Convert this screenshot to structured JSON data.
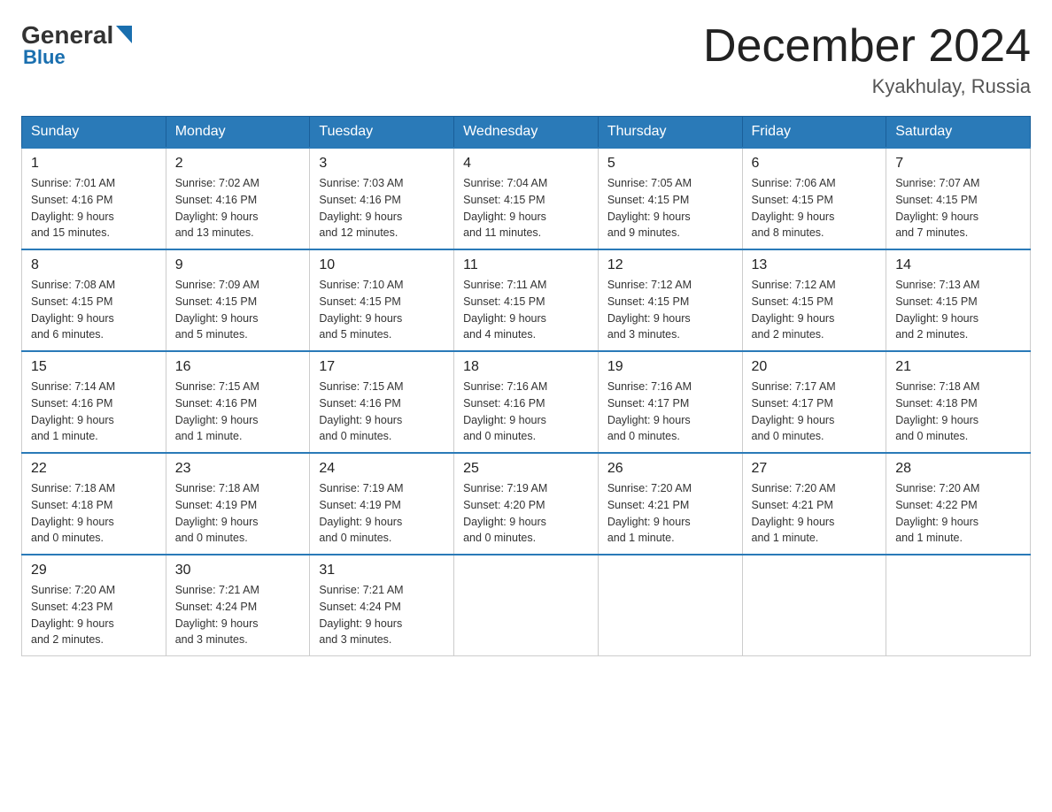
{
  "logo": {
    "general": "General",
    "blue": "Blue"
  },
  "header": {
    "month_title": "December 2024",
    "location": "Kyakhulay, Russia"
  },
  "days_of_week": [
    "Sunday",
    "Monday",
    "Tuesday",
    "Wednesday",
    "Thursday",
    "Friday",
    "Saturday"
  ],
  "weeks": [
    [
      {
        "day": "1",
        "sunrise": "7:01 AM",
        "sunset": "4:16 PM",
        "daylight": "9 hours and 15 minutes."
      },
      {
        "day": "2",
        "sunrise": "7:02 AM",
        "sunset": "4:16 PM",
        "daylight": "9 hours and 13 minutes."
      },
      {
        "day": "3",
        "sunrise": "7:03 AM",
        "sunset": "4:16 PM",
        "daylight": "9 hours and 12 minutes."
      },
      {
        "day": "4",
        "sunrise": "7:04 AM",
        "sunset": "4:15 PM",
        "daylight": "9 hours and 11 minutes."
      },
      {
        "day": "5",
        "sunrise": "7:05 AM",
        "sunset": "4:15 PM",
        "daylight": "9 hours and 9 minutes."
      },
      {
        "day": "6",
        "sunrise": "7:06 AM",
        "sunset": "4:15 PM",
        "daylight": "9 hours and 8 minutes."
      },
      {
        "day": "7",
        "sunrise": "7:07 AM",
        "sunset": "4:15 PM",
        "daylight": "9 hours and 7 minutes."
      }
    ],
    [
      {
        "day": "8",
        "sunrise": "7:08 AM",
        "sunset": "4:15 PM",
        "daylight": "9 hours and 6 minutes."
      },
      {
        "day": "9",
        "sunrise": "7:09 AM",
        "sunset": "4:15 PM",
        "daylight": "9 hours and 5 minutes."
      },
      {
        "day": "10",
        "sunrise": "7:10 AM",
        "sunset": "4:15 PM",
        "daylight": "9 hours and 5 minutes."
      },
      {
        "day": "11",
        "sunrise": "7:11 AM",
        "sunset": "4:15 PM",
        "daylight": "9 hours and 4 minutes."
      },
      {
        "day": "12",
        "sunrise": "7:12 AM",
        "sunset": "4:15 PM",
        "daylight": "9 hours and 3 minutes."
      },
      {
        "day": "13",
        "sunrise": "7:12 AM",
        "sunset": "4:15 PM",
        "daylight": "9 hours and 2 minutes."
      },
      {
        "day": "14",
        "sunrise": "7:13 AM",
        "sunset": "4:15 PM",
        "daylight": "9 hours and 2 minutes."
      }
    ],
    [
      {
        "day": "15",
        "sunrise": "7:14 AM",
        "sunset": "4:16 PM",
        "daylight": "9 hours and 1 minute."
      },
      {
        "day": "16",
        "sunrise": "7:15 AM",
        "sunset": "4:16 PM",
        "daylight": "9 hours and 1 minute."
      },
      {
        "day": "17",
        "sunrise": "7:15 AM",
        "sunset": "4:16 PM",
        "daylight": "9 hours and 0 minutes."
      },
      {
        "day": "18",
        "sunrise": "7:16 AM",
        "sunset": "4:16 PM",
        "daylight": "9 hours and 0 minutes."
      },
      {
        "day": "19",
        "sunrise": "7:16 AM",
        "sunset": "4:17 PM",
        "daylight": "9 hours and 0 minutes."
      },
      {
        "day": "20",
        "sunrise": "7:17 AM",
        "sunset": "4:17 PM",
        "daylight": "9 hours and 0 minutes."
      },
      {
        "day": "21",
        "sunrise": "7:18 AM",
        "sunset": "4:18 PM",
        "daylight": "9 hours and 0 minutes."
      }
    ],
    [
      {
        "day": "22",
        "sunrise": "7:18 AM",
        "sunset": "4:18 PM",
        "daylight": "9 hours and 0 minutes."
      },
      {
        "day": "23",
        "sunrise": "7:18 AM",
        "sunset": "4:19 PM",
        "daylight": "9 hours and 0 minutes."
      },
      {
        "day": "24",
        "sunrise": "7:19 AM",
        "sunset": "4:19 PM",
        "daylight": "9 hours and 0 minutes."
      },
      {
        "day": "25",
        "sunrise": "7:19 AM",
        "sunset": "4:20 PM",
        "daylight": "9 hours and 0 minutes."
      },
      {
        "day": "26",
        "sunrise": "7:20 AM",
        "sunset": "4:21 PM",
        "daylight": "9 hours and 1 minute."
      },
      {
        "day": "27",
        "sunrise": "7:20 AM",
        "sunset": "4:21 PM",
        "daylight": "9 hours and 1 minute."
      },
      {
        "day": "28",
        "sunrise": "7:20 AM",
        "sunset": "4:22 PM",
        "daylight": "9 hours and 1 minute."
      }
    ],
    [
      {
        "day": "29",
        "sunrise": "7:20 AM",
        "sunset": "4:23 PM",
        "daylight": "9 hours and 2 minutes."
      },
      {
        "day": "30",
        "sunrise": "7:21 AM",
        "sunset": "4:24 PM",
        "daylight": "9 hours and 3 minutes."
      },
      {
        "day": "31",
        "sunrise": "7:21 AM",
        "sunset": "4:24 PM",
        "daylight": "9 hours and 3 minutes."
      },
      null,
      null,
      null,
      null
    ]
  ],
  "labels": {
    "sunrise": "Sunrise:",
    "sunset": "Sunset:",
    "daylight": "Daylight:"
  }
}
